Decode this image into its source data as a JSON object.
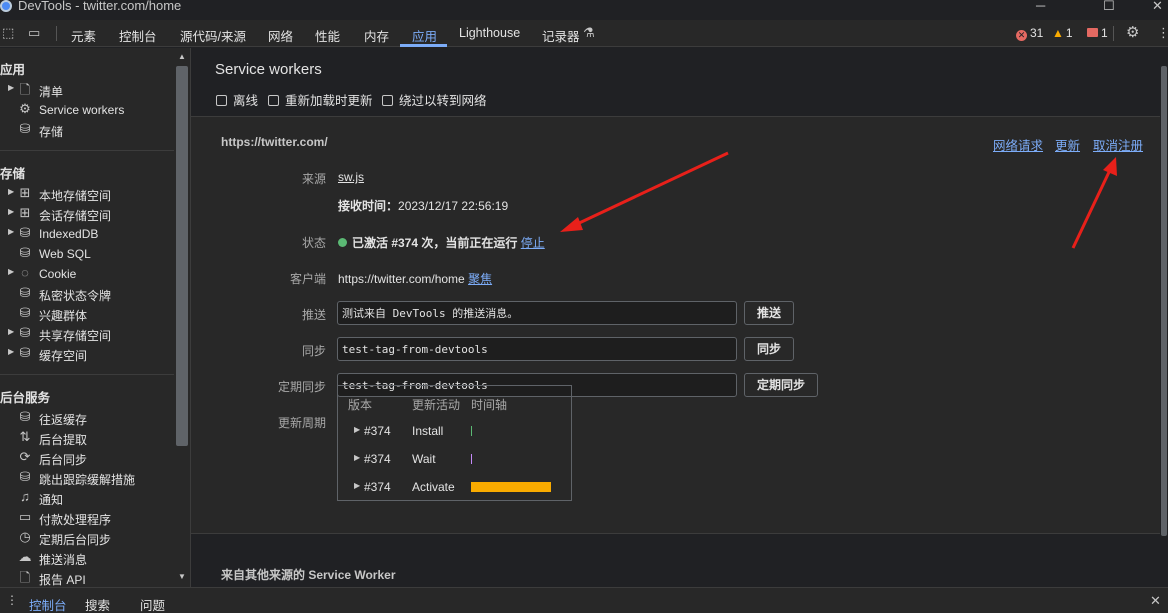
{
  "window": {
    "title": "DevTools - twitter.com/home"
  },
  "toolbar": {
    "tabs": [
      "元素",
      "控制台",
      "源代码/来源",
      "网络",
      "性能",
      "内存",
      "应用",
      "Lighthouse",
      "记录器"
    ],
    "active_tab": "应用",
    "errors": "31",
    "warnings": "1",
    "messages": "1"
  },
  "sidebar": {
    "sections": [
      {
        "title": "应用",
        "items": [
          {
            "label": "清单",
            "icon": "document-icon",
            "expandable": true
          },
          {
            "label": "Service workers",
            "icon": "gears-icon",
            "expandable": false
          },
          {
            "label": "存储",
            "icon": "database-icon",
            "expandable": false
          }
        ]
      },
      {
        "title": "存储",
        "items": [
          {
            "label": "本地存储空间",
            "icon": "table-icon",
            "expandable": true
          },
          {
            "label": "会话存储空间",
            "icon": "table-icon",
            "expandable": true
          },
          {
            "label": "IndexedDB",
            "icon": "database-icon",
            "expandable": true
          },
          {
            "label": "Web SQL",
            "icon": "database-icon",
            "expandable": false
          },
          {
            "label": "Cookie",
            "icon": "cookie-icon",
            "expandable": true
          },
          {
            "label": "私密状态令牌",
            "icon": "database-icon",
            "expandable": false
          },
          {
            "label": "兴趣群体",
            "icon": "database-icon",
            "expandable": false
          },
          {
            "label": "共享存储空间",
            "icon": "database-icon",
            "expandable": true
          },
          {
            "label": "缓存空间",
            "icon": "database-icon",
            "expandable": true
          }
        ]
      },
      {
        "title": "后台服务",
        "items": [
          {
            "label": "往返缓存",
            "icon": "database-icon",
            "expandable": false
          },
          {
            "label": "后台提取",
            "icon": "sort-icon",
            "expandable": false
          },
          {
            "label": "后台同步",
            "icon": "sync-icon",
            "expandable": false
          },
          {
            "label": "跳出跟踪缓解措施",
            "icon": "database-icon",
            "expandable": false
          },
          {
            "label": "通知",
            "icon": "bell-icon",
            "expandable": false
          },
          {
            "label": "付款处理程序",
            "icon": "card-icon",
            "expandable": false
          },
          {
            "label": "定期后台同步",
            "icon": "clock-icon",
            "expandable": false
          },
          {
            "label": "推送消息",
            "icon": "cloud-icon",
            "expandable": false
          },
          {
            "label": "报告 API",
            "icon": "document-icon",
            "expandable": false
          }
        ]
      }
    ]
  },
  "main": {
    "title": "Service workers",
    "checkboxes": [
      "离线",
      "重新加载时更新",
      "绕过以转到网络"
    ],
    "worker": {
      "origin": "https://twitter.com/",
      "links": [
        "网络请求",
        "更新",
        "取消注册"
      ],
      "source_label": "来源",
      "source_file": "sw.js",
      "received_label": "接收时间：",
      "received_time": "2023/12/17 22:56:19",
      "status_label": "状态",
      "status_text": "已激活 #374 次，当前正在运行",
      "stop_link": "停止",
      "clients_label": "客户端",
      "client_url": "https://twitter.com/home",
      "focus_link": "聚焦",
      "push_label": "推送",
      "push_value": "测试来自 DevTools 的推送消息。",
      "push_button": "推送",
      "sync_label": "同步",
      "sync_value": "test-tag-from-devtools",
      "sync_button": "同步",
      "periodic_label": "定期同步",
      "periodic_value": "test-tag-from-devtools",
      "periodic_button": "定期同步",
      "cycle_label": "更新周期",
      "cycle_headers": [
        "版本",
        "更新活动",
        "时间轴"
      ],
      "cycle_rows": [
        {
          "version": "#374",
          "activity": "Install",
          "color": "#5bb974",
          "fill": 0.01
        },
        {
          "version": "#374",
          "activity": "Wait",
          "color": "#c58af9",
          "fill": 0.01
        },
        {
          "version": "#374",
          "activity": "Activate",
          "color": "#f9ab00",
          "fill": 1.0
        }
      ]
    },
    "other_origins": "来自其他来源的 Service Worker"
  },
  "drawer": {
    "tabs": [
      "控制台",
      "搜索",
      "问题"
    ],
    "active": "控制台"
  },
  "colors": {
    "accent": "#7cacf8",
    "annotation_arrow": "#e8201a"
  }
}
